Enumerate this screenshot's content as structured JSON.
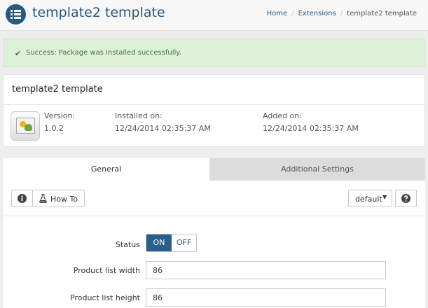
{
  "header": {
    "title": "template2 template",
    "icon": "list-menu-icon",
    "breadcrumbs": [
      "Home",
      "Extensions",
      "template2 template"
    ]
  },
  "alert": {
    "icon": "check-icon",
    "message": "Success: Package was installed successfully."
  },
  "extension": {
    "title": "template2 template",
    "thumbnail": "image-placeholder-icon",
    "version_label": "Version:",
    "version": "1.0.2",
    "installed_label": "Installed on:",
    "installed_on": "12/24/2014 02:35:37 AM",
    "added_label": "Added on:",
    "added_on": "12/24/2014 02:35:37 AM"
  },
  "tabs": [
    {
      "label": "General",
      "active": true
    },
    {
      "label": "Additional Settings",
      "active": false
    }
  ],
  "toolbar": {
    "info_icon": "info-icon",
    "howto_icon": "flask-icon",
    "howto_label": "How To",
    "store_select": "default",
    "help_icon": "question-icon"
  },
  "form": {
    "status_label": "Status",
    "status_on": "ON",
    "status_off": "OFF",
    "status_value": "ON",
    "width_label": "Product list width",
    "width_value": "86",
    "height_label": "Product list height",
    "height_value": "86"
  },
  "colors": {
    "brand": "#255a85",
    "success_bg": "#dff0d8",
    "success_text": "#3c763d",
    "toggle_active": "#2a5f8c"
  }
}
